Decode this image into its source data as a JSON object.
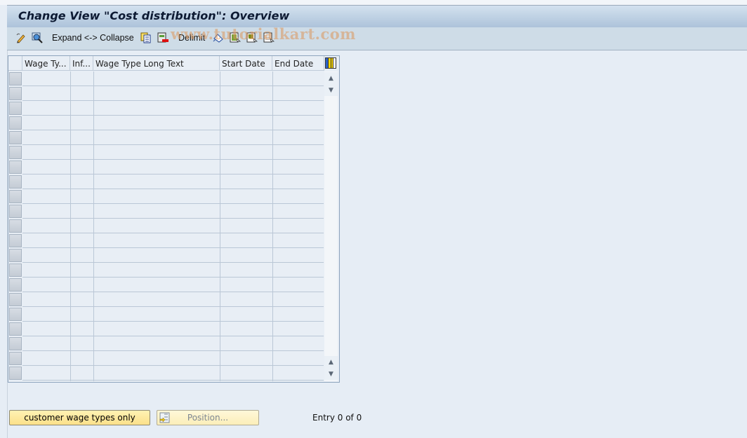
{
  "window": {
    "title": "Change View \"Cost distribution\": Overview"
  },
  "toolbar": {
    "items": [
      {
        "icon": "edit-pencil-icon",
        "label": ""
      },
      {
        "icon": "display-magnifier-icon",
        "label": ""
      },
      {
        "icon": "",
        "label": "Expand <-> Collapse"
      },
      {
        "icon": "copy-icon",
        "label": ""
      },
      {
        "icon": "delete-icon",
        "label": ""
      },
      {
        "icon": "",
        "label": "Delimit"
      },
      {
        "icon": "undo-change-icon",
        "label": ""
      },
      {
        "icon": "select-all-icon",
        "label": ""
      },
      {
        "icon": "select-block-icon",
        "label": ""
      },
      {
        "icon": "deselect-all-icon",
        "label": ""
      }
    ],
    "expand_collapse_label": "Expand <-> Collapse",
    "delimit_label": "Delimit"
  },
  "watermark": "www.tutorialkart.com",
  "table": {
    "columns": [
      "Wage Ty...",
      "Inf...",
      "Wage Type Long Text",
      "Start Date",
      "End Date"
    ],
    "row_count_visible": 21,
    "rows": []
  },
  "footer": {
    "customer_button_label": "customer wage types only",
    "position_button_label": "Position...",
    "entry_status": "Entry 0 of 0"
  }
}
